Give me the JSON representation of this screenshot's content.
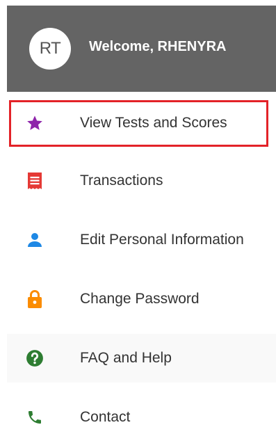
{
  "header": {
    "avatar_initials": "RT",
    "welcome_text": "Welcome, RHENYRA",
    "background_color": "#646464"
  },
  "menu": {
    "items": [
      {
        "label": "View Tests and Scores",
        "icon": "star-icon",
        "icon_color": "#8e24aa",
        "highlighted": true
      },
      {
        "label": "Transactions",
        "icon": "receipt-icon",
        "icon_color": "#e53935",
        "highlighted": false
      },
      {
        "label": "Edit Personal Information",
        "icon": "person-icon",
        "icon_color": "#1e88e5",
        "highlighted": false
      },
      {
        "label": "Change Password",
        "icon": "lock-icon",
        "icon_color": "#fb8c00",
        "highlighted": false
      },
      {
        "label": "FAQ and Help",
        "icon": "help-circle-icon",
        "icon_color": "#2e7d32",
        "highlighted": false
      },
      {
        "label": "Contact",
        "icon": "phone-icon",
        "icon_color": "#2e7d32",
        "highlighted": false
      }
    ],
    "highlight_color": "#e32228"
  }
}
